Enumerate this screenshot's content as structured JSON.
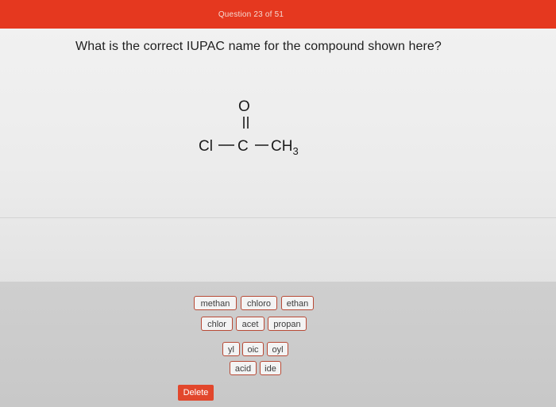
{
  "header": {
    "title": "Question 23 of 51"
  },
  "question": {
    "text": "What is the correct IUPAC name for the compound shown here?"
  },
  "structure": {
    "oxygen": "O",
    "chlorine": "Cl",
    "carbon": "C",
    "methyl": "CH",
    "methyl_subscript": "3",
    "bond_single": "—",
    "bond_single_short": "–"
  },
  "tiles": {
    "row1": [
      "methan",
      "chloro",
      "ethan"
    ],
    "row2": [
      "chlor",
      "acet",
      "propan"
    ],
    "row3": [
      "yl",
      "oic",
      "oyl"
    ],
    "row4": [
      "acid",
      "ide"
    ]
  },
  "actions": {
    "delete_label": "Delete"
  },
  "colors": {
    "header": "#e5381f",
    "tile_border": "#b84a36",
    "delete_button": "#e2472c"
  }
}
